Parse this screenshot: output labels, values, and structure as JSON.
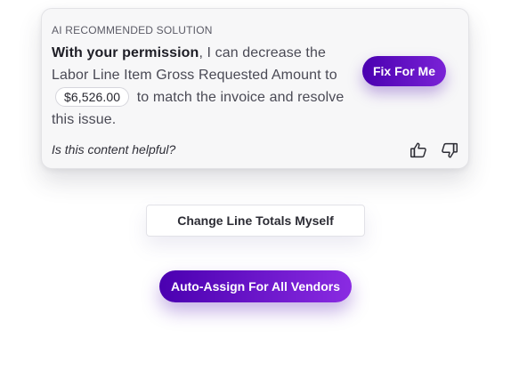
{
  "recommendation": {
    "eyebrow": "AI RECOMMENDED SOLUTION",
    "message_bold": "With your permission",
    "message_part1": ", I can decrease the Labor Line Item Gross Requested Amount to",
    "amount": "$6,526.00",
    "message_part2": "to match the invoice and resolve this issue.",
    "fix_button_label": "Fix For Me",
    "helpful_question": "Is this content helpful?",
    "thumbs_up_icon": "thumbs-up-icon",
    "thumbs_down_icon": "thumbs-down-icon"
  },
  "actions": {
    "change_totals_label": "Change Line Totals Myself",
    "auto_assign_label": "Auto-Assign For All Vendors"
  },
  "colors": {
    "primary_gradient_start": "#4a00b0",
    "primary_gradient_end": "#8a2be2",
    "card_background": "#f7f7f8"
  }
}
